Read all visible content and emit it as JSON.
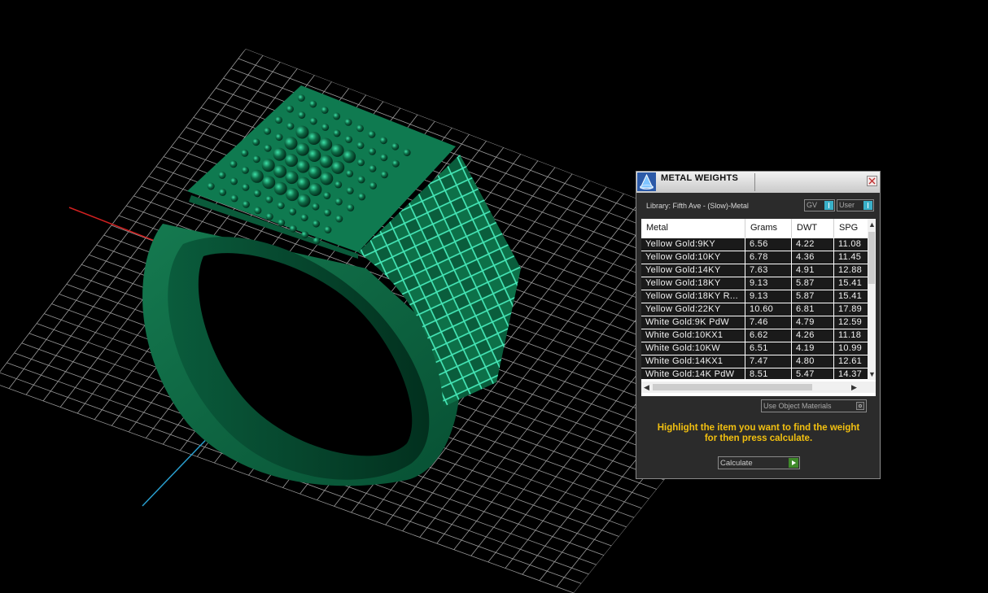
{
  "panel": {
    "title": "METAL WEIGHTS",
    "library": "Library: Fifth Ave - (Slow)-Metal",
    "gv_label": "GV",
    "user_label": "User",
    "columns": [
      "Metal",
      "Grams",
      "DWT",
      "SPG"
    ],
    "rows": [
      {
        "metal": "Yellow Gold:9KY",
        "grams": "6.56",
        "dwt": "4.22",
        "spg": "11.08"
      },
      {
        "metal": "Yellow Gold:10KY",
        "grams": "6.78",
        "dwt": "4.36",
        "spg": "11.45"
      },
      {
        "metal": "Yellow Gold:14KY",
        "grams": "7.63",
        "dwt": "4.91",
        "spg": "12.88"
      },
      {
        "metal": "Yellow Gold:18KY",
        "grams": "9.13",
        "dwt": "5.87",
        "spg": "15.41"
      },
      {
        "metal": "Yellow Gold:18KY R...",
        "grams": "9.13",
        "dwt": "5.87",
        "spg": "15.41"
      },
      {
        "metal": "Yellow Gold:22KY",
        "grams": "10.60",
        "dwt": "6.81",
        "spg": "17.89"
      },
      {
        "metal": "White Gold:9K PdW",
        "grams": "7.46",
        "dwt": "4.79",
        "spg": "12.59"
      },
      {
        "metal": "White Gold:10KX1",
        "grams": "6.62",
        "dwt": "4.26",
        "spg": "11.18"
      },
      {
        "metal": "White Gold:10KW",
        "grams": "6.51",
        "dwt": "4.19",
        "spg": "10.99"
      },
      {
        "metal": "White Gold:14KX1",
        "grams": "7.47",
        "dwt": "4.80",
        "spg": "12.61"
      },
      {
        "metal": "White Gold:14K PdW",
        "grams": "8.51",
        "dwt": "5.47",
        "spg": "14.37"
      }
    ],
    "use_object_materials": "Use Object Materials",
    "hint_line1": "Highlight the item you want to find the weight",
    "hint_line2": "for then press calculate.",
    "calculate_label": "Calculate"
  },
  "colors": {
    "ring": "#0f6b45",
    "grid": "#9a9a9a",
    "hint": "#f2c010",
    "x_axis": "#d02020",
    "y_axis": "#2aa0d0"
  }
}
